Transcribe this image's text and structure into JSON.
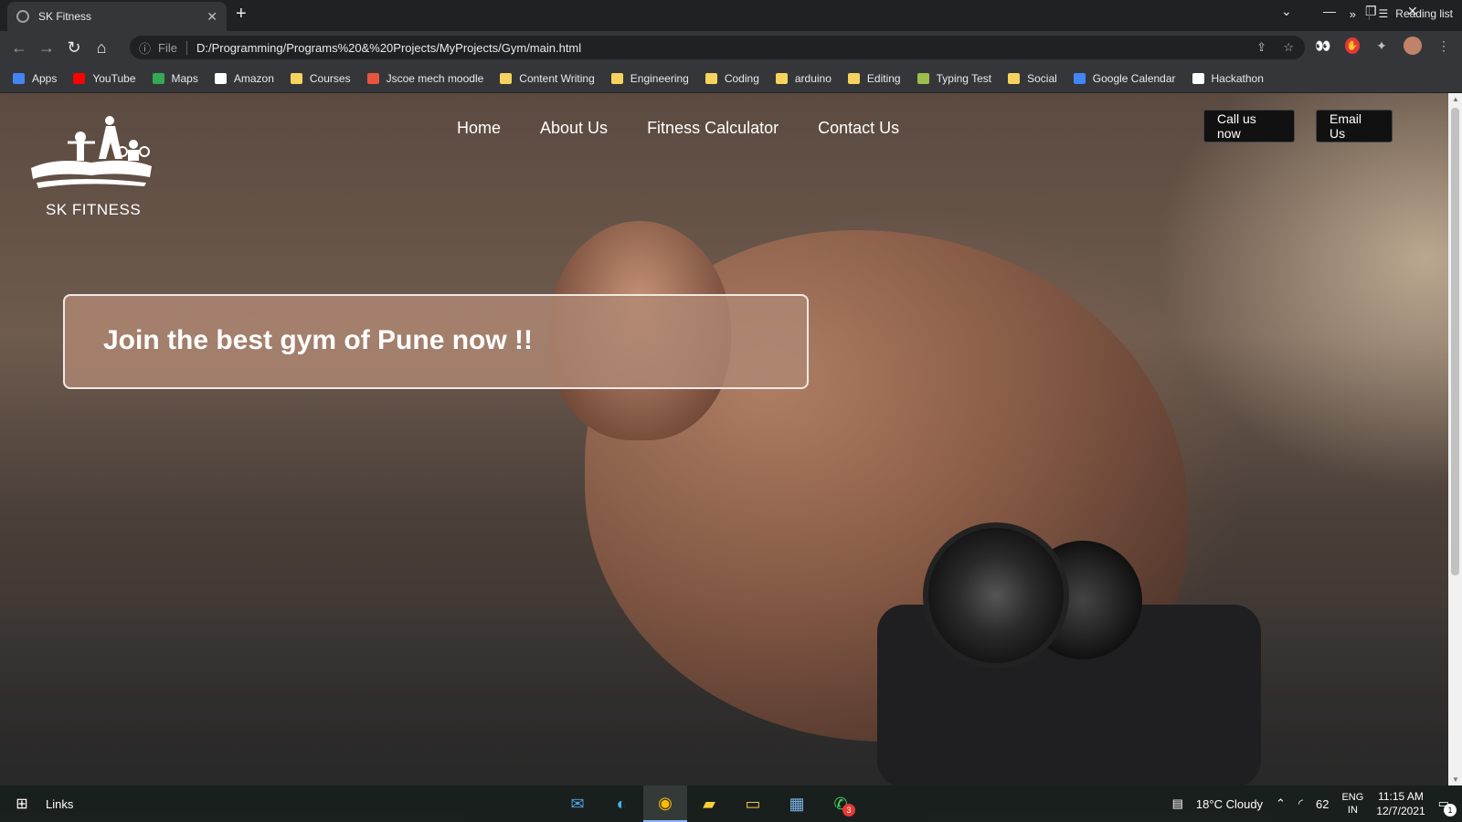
{
  "browser": {
    "tab_title": "SK Fitness",
    "url_scheme": "File",
    "url": "D:/Programming/Programs%20&%20Projects/MyProjects/Gym/main.html"
  },
  "bookmarks": [
    {
      "label": "Apps",
      "icon": "apps-grid-icon",
      "color": "#4285f4"
    },
    {
      "label": "YouTube",
      "icon": "youtube-icon",
      "color": "#ff0000"
    },
    {
      "label": "Maps",
      "icon": "maps-pin-icon",
      "color": "#34a853"
    },
    {
      "label": "Amazon",
      "icon": "amazon-icon",
      "color": "#ffffff"
    },
    {
      "label": "Courses",
      "icon": "folder-icon",
      "color": "#f4d35e"
    },
    {
      "label": "Jscoe mech moodle",
      "icon": "moodle-icon",
      "color": "#e8553e"
    },
    {
      "label": "Content Writing",
      "icon": "folder-icon",
      "color": "#f4d35e"
    },
    {
      "label": "Engineering",
      "icon": "folder-icon",
      "color": "#f4d35e"
    },
    {
      "label": "Coding",
      "icon": "folder-icon",
      "color": "#f4d35e"
    },
    {
      "label": "arduino",
      "icon": "folder-icon",
      "color": "#f4d35e"
    },
    {
      "label": "Editing",
      "icon": "folder-icon",
      "color": "#f4d35e"
    },
    {
      "label": "Typing Test",
      "icon": "typing-test-icon",
      "color": "#9bbf4a"
    },
    {
      "label": "Social",
      "icon": "folder-icon",
      "color": "#f4d35e"
    },
    {
      "label": "Google Calendar",
      "icon": "google-calendar-icon",
      "color": "#4285f4"
    },
    {
      "label": "Hackathon",
      "icon": "hackathon-icon",
      "color": "#ffffff"
    }
  ],
  "bookmarks_more": "»",
  "reading_list": "Reading list",
  "site": {
    "brand": "SK FITNESS",
    "nav": [
      "Home",
      "About Us",
      "Fitness Calculator",
      "Contact Us"
    ],
    "call_button": "Call us now",
    "email_button": "Email Us",
    "hero_text": "Join the best gym of Pune now !!"
  },
  "taskbar": {
    "links_label": "Links",
    "weather": "18°C  Cloudy",
    "battery": "62",
    "lang_top": "ENG",
    "lang_bottom": "IN",
    "time": "11:15 AM",
    "date": "12/7/2021",
    "notification_count": "1",
    "whatsapp_badge": "3"
  }
}
